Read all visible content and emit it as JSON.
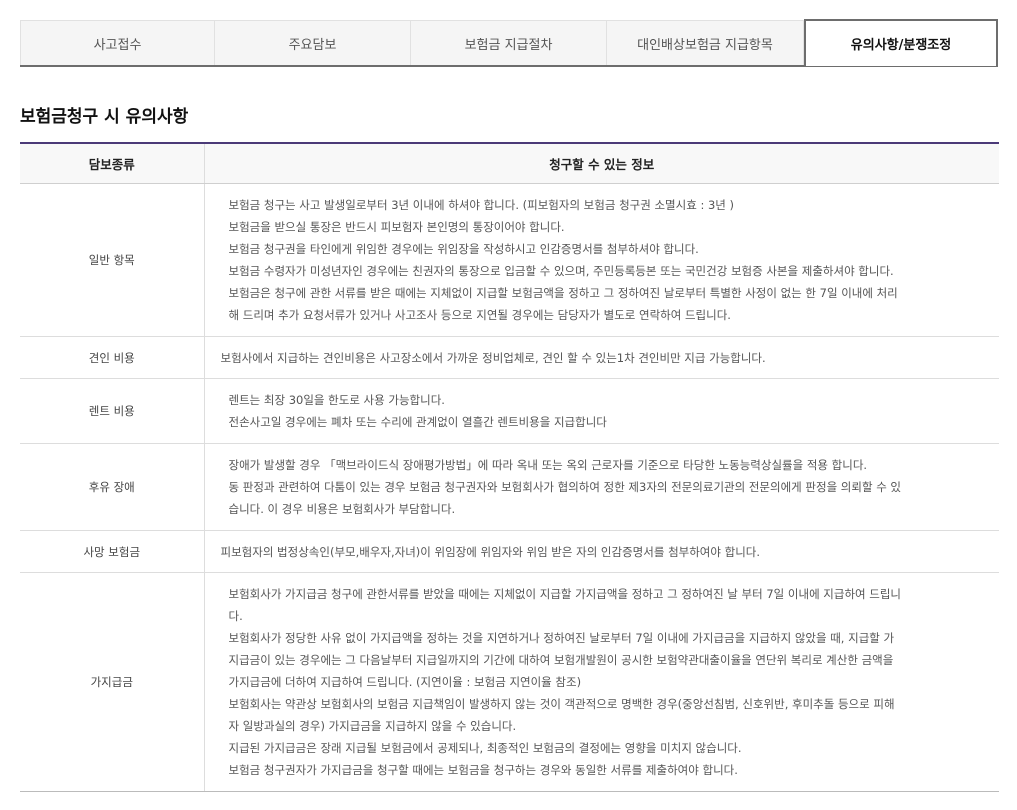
{
  "tabs": [
    {
      "label": "사고접수"
    },
    {
      "label": "주요담보"
    },
    {
      "label": "보험금 지급절차"
    },
    {
      "label": "대인배상보험금 지급항목"
    },
    {
      "label": "유의사항/분쟁조정"
    }
  ],
  "active_tab": "유의사항/분쟁조정",
  "section_title": "보험금청구 시 유의사항",
  "table": {
    "headers": [
      "담보종류",
      "청구할 수 있는 정보"
    ],
    "rows": [
      {
        "category": "일반 항목",
        "lines": [
          "보험금 청구는 사고 발생일로부터 3년 이내에 하셔야 합니다. (피보험자의 보험금 청구권 소멸시효 : 3년 )",
          "보험금을 받으실 통장은 반드시 피보험자 본인명의 통장이어야 합니다.",
          "보험금 청구권을 타인에게 위임한 경우에는 위임장을 작성하시고 인감증명서를 첨부하셔야 합니다.",
          "보험금 수령자가 미성년자인 경우에는 친권자의 통장으로 입금할 수 있으며, 주민등록등본 또는 국민건강 보험증 사본을 제출하셔야 합니다.",
          "보험금은 청구에 관한 서류를 받은 때에는 지체없이 지급할 보험금액을 정하고 그 정하여진 날로부터 특별한 사정이 없는 한 7일 이내에 처리",
          "해 드리며 추가 요청서류가 있거나 사고조사 등으로 지연될 경우에는 담당자가 별도로 연락하여 드립니다."
        ]
      },
      {
        "category": "견인 비용",
        "lines": [
          "보험사에서 지급하는 견인비용은 사고장소에서 가까운 정비업체로, 견인 할 수 있는1차 견인비만 지급 가능합니다."
        ]
      },
      {
        "category": "렌트 비용",
        "lines": [
          "렌트는 최장 30일을 한도로 사용 가능합니다.",
          "전손사고일 경우에는 폐차 또는 수리에 관계없이 열흘간 렌트비용을 지급합니다"
        ]
      },
      {
        "category": "후유 장애",
        "lines": [
          "장애가 발생할 경우 「맥브라이드식 장애평가방법」에 따라 옥내 또는 옥외 근로자를 기준으로 타당한 노동능력상실률을 적용 합니다.",
          "동 판정과 관련하여 다툼이 있는 경우 보험금 청구권자와 보험회사가 협의하여 정한 제3자의 전문의료기관의 전문의에게 판정을 의뢰할 수 있",
          "습니다. 이 경우 비용은 보험회사가 부담합니다."
        ]
      },
      {
        "category": "사망 보험금",
        "lines": [
          "피보험자의 법정상속인(부모,배우자,자녀)이 위임장에 위임자와 위임 받은 자의 인감증명서를 첨부하여야 합니다."
        ]
      },
      {
        "category": "가지급금",
        "lines": [
          "보험회사가 가지급금 청구에 관한서류를 받았을 때에는 지체없이 지급할 가지급액을 정하고 그 정하여진 날 부터 7일 이내에 지급하여 드립니",
          "다.",
          "보험회사가 정당한 사유 없이 가지급액을 정하는 것을 지연하거나 정하여진 날로부터 7일 이내에 가지급금을 지급하지 않았을 때, 지급할 가",
          "지급금이 있는 경우에는 그 다음날부터 지급일까지의 기간에 대하여 보험개발원이 공시한 보험약관대출이율을 연단위 복리로 계산한 금액을",
          "가지급금에 더하여 지급하여 드립니다. (지연이율 : 보험금 지연이율 참조)",
          "보험회사는 약관상 보험회사의 보험금 지급책임이 발생하지 않는 것이 객관적으로 명백한 경우(중앙선침범, 신호위반, 후미추돌 등으로 피해",
          "자 일방과실의 경우) 가지급금을 지급하지 않을 수 있습니다.",
          "지급된 가지급금은 장래 지급될 보험금에서 공제되나, 최종적인 보험금의 결정에는 영향을 미치지 않습니다.",
          "보험금 청구권자가 가지급금을 청구할 때에는 보험금을 청구하는 경우와 동일한 서류를 제출하여야 합니다."
        ]
      }
    ]
  }
}
